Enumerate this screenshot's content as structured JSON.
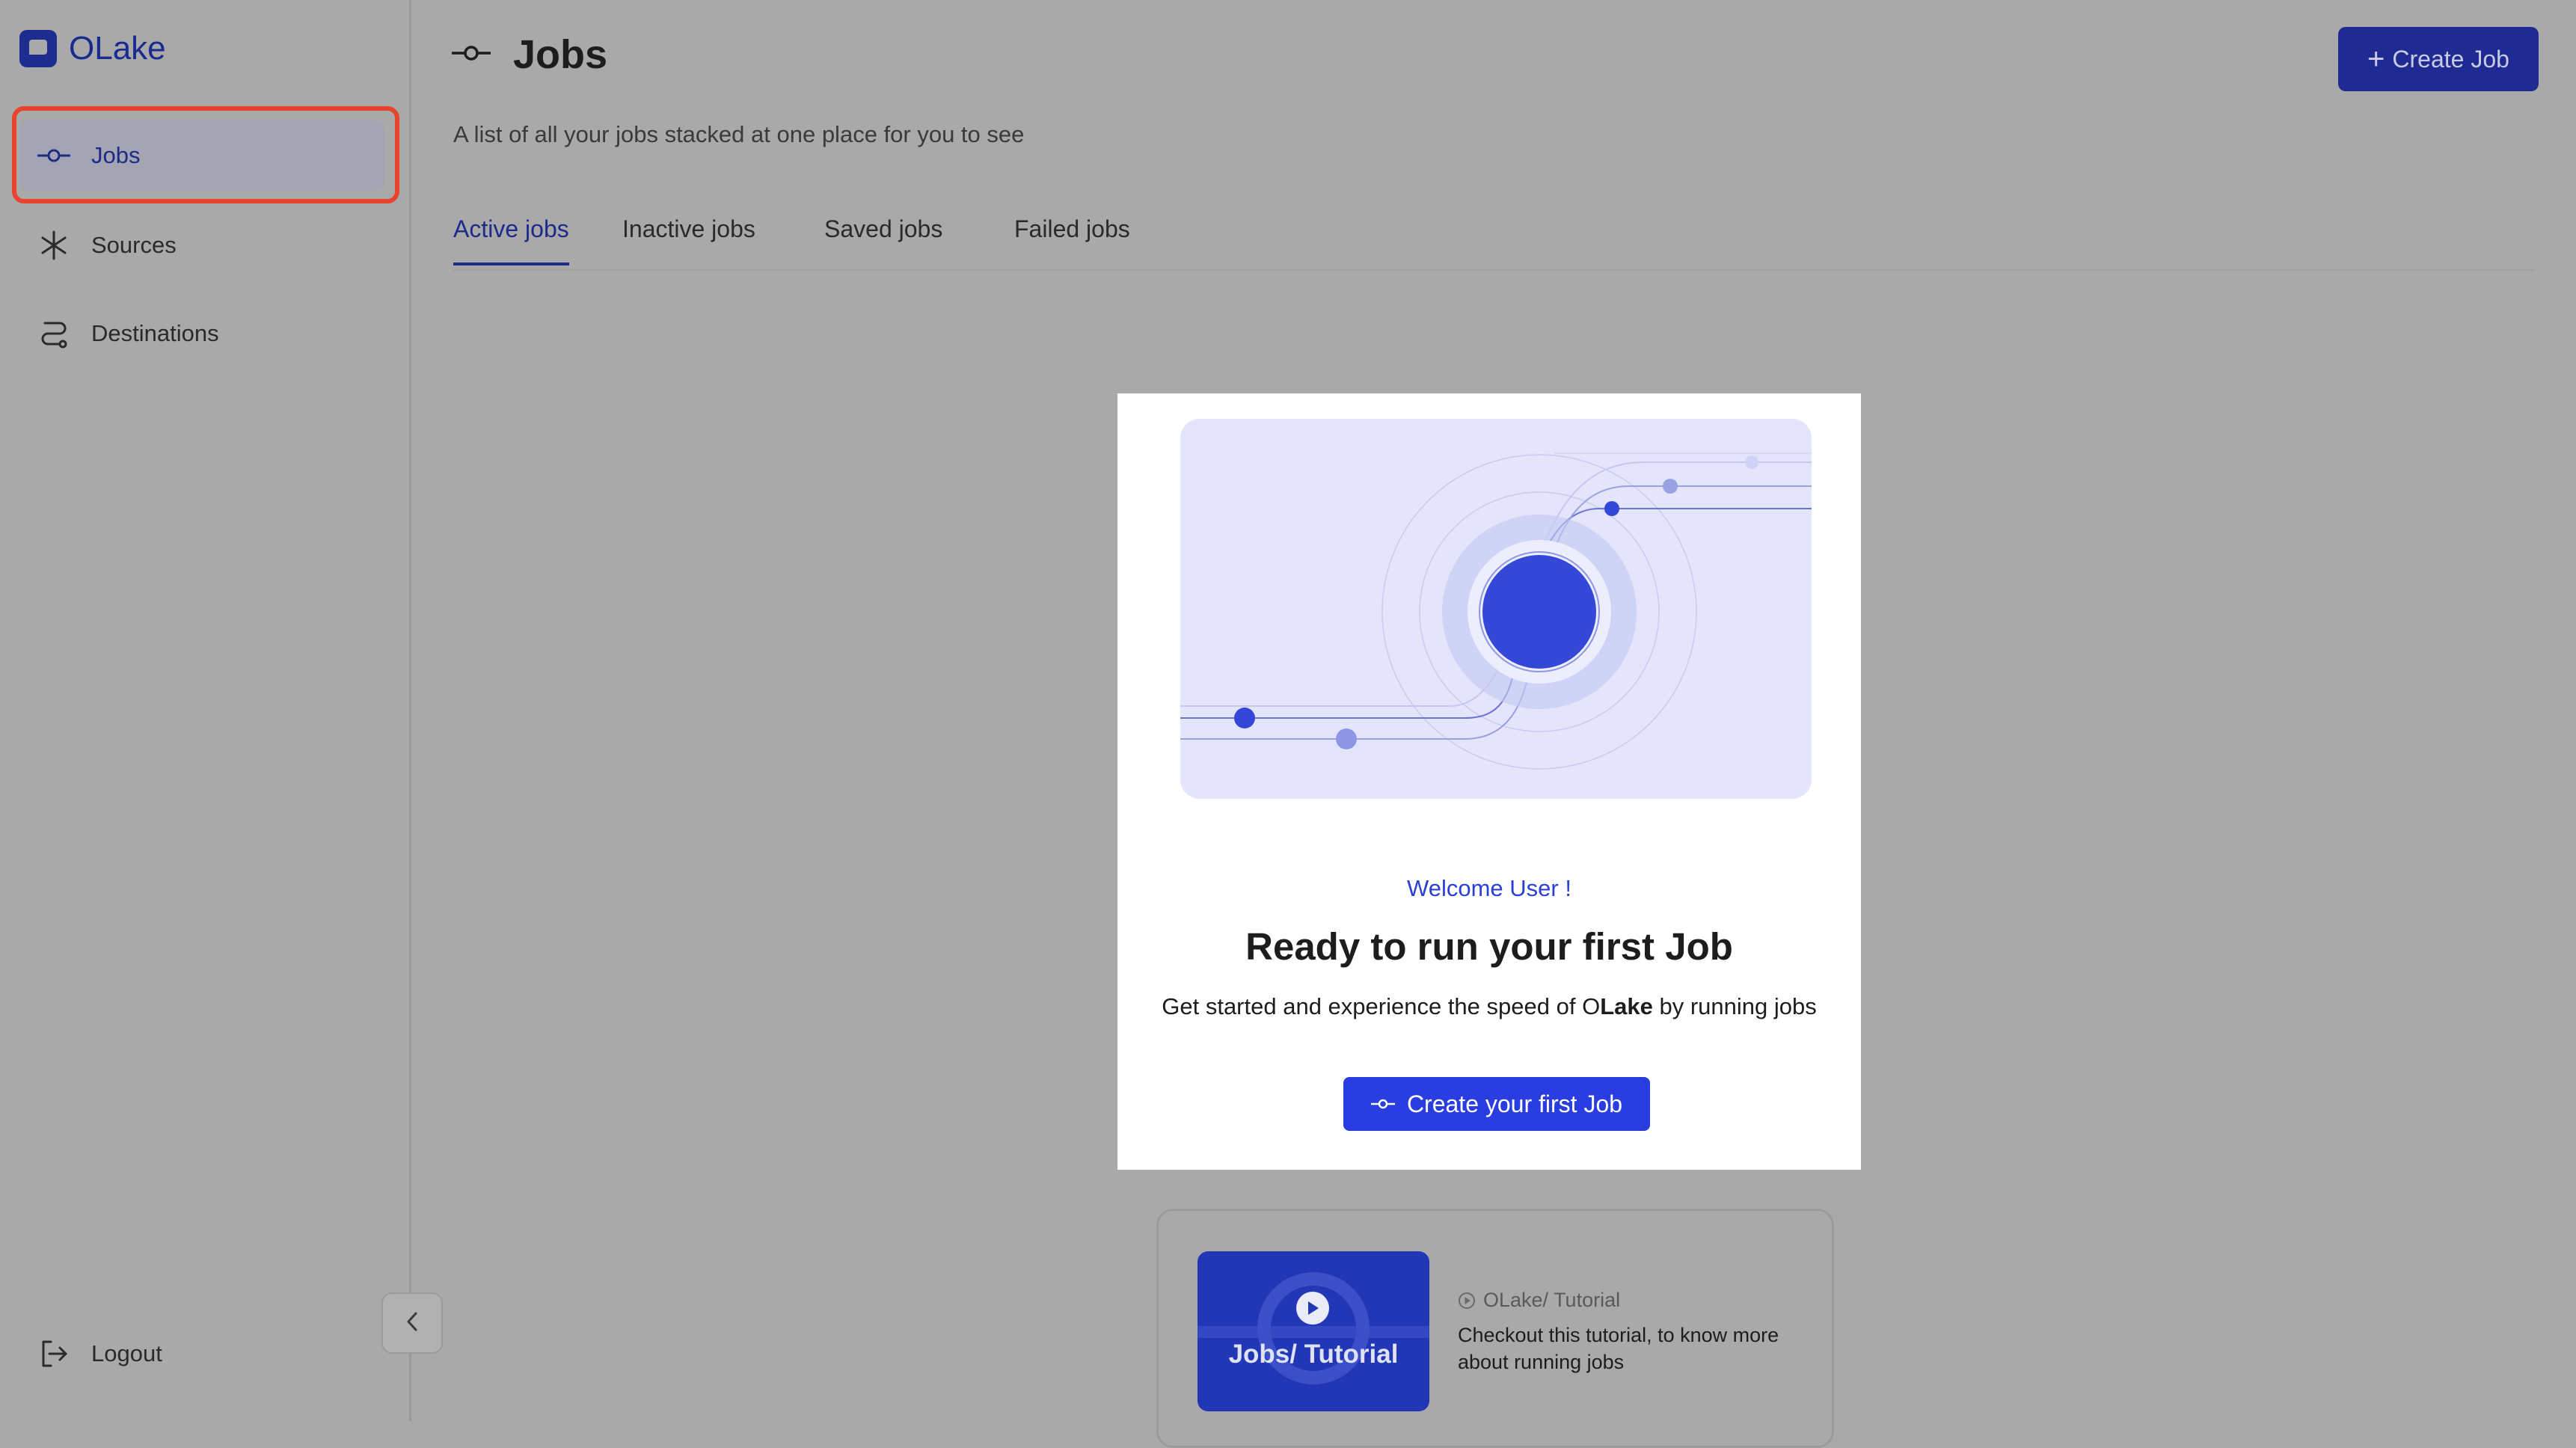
{
  "app": {
    "name": "OLake"
  },
  "sidebar": {
    "items": [
      {
        "label": "Jobs",
        "icon": "commit-icon",
        "active": true
      },
      {
        "label": "Sources",
        "icon": "asterisk-icon",
        "active": false
      },
      {
        "label": "Destinations",
        "icon": "route-icon",
        "active": false
      }
    ],
    "logout_label": "Logout"
  },
  "header": {
    "title": "Jobs",
    "subtitle": "A list of all your jobs stacked at one place for you to see",
    "create_button_label": "Create Job"
  },
  "tabs": [
    {
      "label": "Active jobs",
      "active": true
    },
    {
      "label": "Inactive jobs",
      "active": false
    },
    {
      "label": "Saved jobs",
      "active": false
    },
    {
      "label": "Failed jobs",
      "active": false
    }
  ],
  "welcome": {
    "greeting": "Welcome User !",
    "heading": "Ready to run your first Job",
    "text_before": "Get started and experience the speed of ",
    "brand_prefix": "O",
    "brand_bold": "Lake",
    "text_after": " by running jobs",
    "button_label": "Create your first Job"
  },
  "tutorial": {
    "thumbnail_text": "Jobs/ Tutorial",
    "source": "OLake/ Tutorial",
    "description": "Checkout this tutorial, to know more about running jobs"
  },
  "colors": {
    "accent": "#1f2b93",
    "primary_button": "#2a3de0",
    "highlight": "#e8432d"
  }
}
